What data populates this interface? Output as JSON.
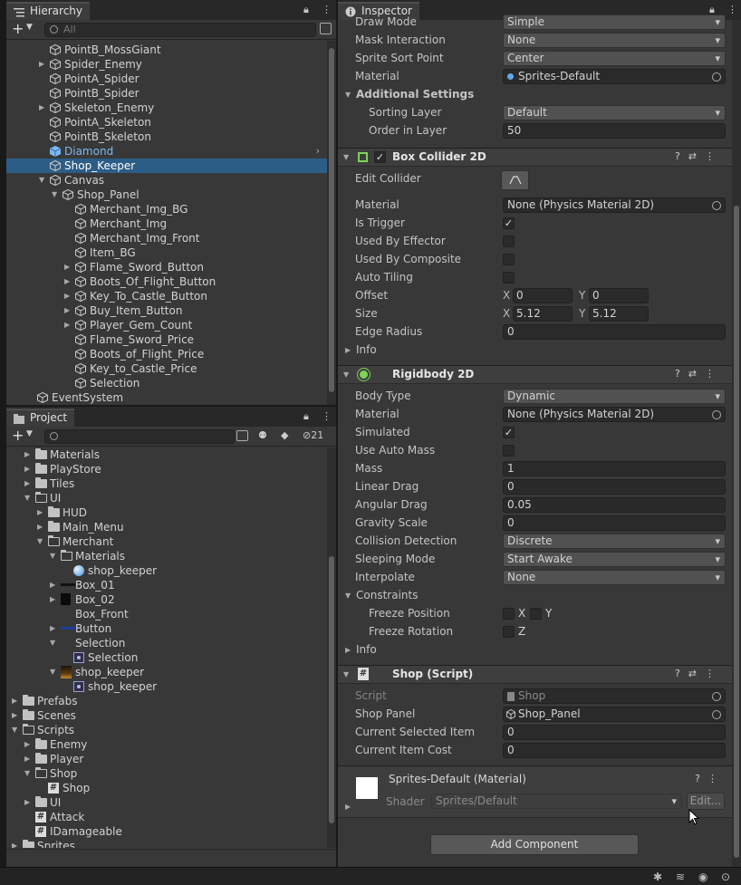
{
  "hierarchy": {
    "tab_label": "Hierarchy",
    "search_placeholder": "All",
    "lock_count": "",
    "items": [
      {
        "label": "PointB_MossGiant",
        "depth": 2,
        "arrow": "",
        "icon": "cube",
        "selected": false
      },
      {
        "label": "Spider_Enemy",
        "depth": 2,
        "arrow": "▶",
        "icon": "cube",
        "selected": false
      },
      {
        "label": "PointA_Spider",
        "depth": 2,
        "arrow": "",
        "icon": "cube",
        "selected": false
      },
      {
        "label": "PointB_Spider",
        "depth": 2,
        "arrow": "",
        "icon": "cube",
        "selected": false
      },
      {
        "label": "Skeleton_Enemy",
        "depth": 2,
        "arrow": "▶",
        "icon": "cube",
        "selected": false
      },
      {
        "label": "PointA_Skeleton",
        "depth": 2,
        "arrow": "",
        "icon": "cube",
        "selected": false
      },
      {
        "label": "PointB_Skeleton",
        "depth": 2,
        "arrow": "",
        "icon": "cube",
        "selected": false
      },
      {
        "label": "Diamond",
        "depth": 2,
        "arrow": "",
        "icon": "prefab",
        "selected": false,
        "prefab": true
      },
      {
        "label": "Shop_Keeper",
        "depth": 2,
        "arrow": "",
        "icon": "cube",
        "selected": true
      },
      {
        "label": "Canvas",
        "depth": 2,
        "arrow": "▼",
        "icon": "cube",
        "selected": false
      },
      {
        "label": "Shop_Panel",
        "depth": 3,
        "arrow": "▼",
        "icon": "cube",
        "selected": false
      },
      {
        "label": "Merchant_Img_BG",
        "depth": 4,
        "arrow": "",
        "icon": "cube",
        "selected": false
      },
      {
        "label": "Merchant_Img",
        "depth": 4,
        "arrow": "",
        "icon": "cube",
        "selected": false
      },
      {
        "label": "Merchant_Img_Front",
        "depth": 4,
        "arrow": "",
        "icon": "cube",
        "selected": false
      },
      {
        "label": "Item_BG",
        "depth": 4,
        "arrow": "",
        "icon": "cube",
        "selected": false
      },
      {
        "label": "Flame_Sword_Button",
        "depth": 4,
        "arrow": "▶",
        "icon": "cube",
        "selected": false
      },
      {
        "label": "Boots_Of_Flight_Button",
        "depth": 4,
        "arrow": "▶",
        "icon": "cube",
        "selected": false
      },
      {
        "label": "Key_To_Castle_Button",
        "depth": 4,
        "arrow": "▶",
        "icon": "cube",
        "selected": false
      },
      {
        "label": "Buy_Item_Button",
        "depth": 4,
        "arrow": "▶",
        "icon": "cube",
        "selected": false
      },
      {
        "label": "Player_Gem_Count",
        "depth": 4,
        "arrow": "▶",
        "icon": "cube",
        "selected": false
      },
      {
        "label": "Flame_Sword_Price",
        "depth": 4,
        "arrow": "",
        "icon": "cube",
        "selected": false
      },
      {
        "label": "Boots_of_Flight_Price",
        "depth": 4,
        "arrow": "",
        "icon": "cube",
        "selected": false
      },
      {
        "label": "Key_to_Castle_Price",
        "depth": 4,
        "arrow": "",
        "icon": "cube",
        "selected": false
      },
      {
        "label": "Selection",
        "depth": 4,
        "arrow": "",
        "icon": "cube",
        "selected": false
      },
      {
        "label": "EventSystem",
        "depth": 1,
        "arrow": "",
        "icon": "cube",
        "selected": false
      }
    ]
  },
  "project": {
    "tab_label": "Project",
    "hidden_count": "21",
    "items": [
      {
        "label": "Materials",
        "depth": 2,
        "arrow": "▶",
        "icon": "folder"
      },
      {
        "label": "PlayStore",
        "depth": 2,
        "arrow": "▶",
        "icon": "folder"
      },
      {
        "label": "Tiles",
        "depth": 2,
        "arrow": "▶",
        "icon": "folder"
      },
      {
        "label": "UI",
        "depth": 2,
        "arrow": "▼",
        "icon": "folder-open"
      },
      {
        "label": "HUD",
        "depth": 3,
        "arrow": "▶",
        "icon": "folder"
      },
      {
        "label": "Main_Menu",
        "depth": 3,
        "arrow": "▶",
        "icon": "folder"
      },
      {
        "label": "Merchant",
        "depth": 3,
        "arrow": "▼",
        "icon": "folder-open"
      },
      {
        "label": "Materials",
        "depth": 4,
        "arrow": "▼",
        "icon": "folder-open"
      },
      {
        "label": "shop_keeper",
        "depth": 5,
        "arrow": "",
        "icon": "material"
      },
      {
        "label": "Box_01",
        "depth": 4,
        "arrow": "▶",
        "icon": "sprite-dark"
      },
      {
        "label": "Box_02",
        "depth": 4,
        "arrow": "▶",
        "icon": "sprite-black"
      },
      {
        "label": "Box_Front",
        "depth": 4,
        "arrow": "",
        "icon": "none"
      },
      {
        "label": "Button",
        "depth": 4,
        "arrow": "▶",
        "icon": "sprite-blue"
      },
      {
        "label": "Selection",
        "depth": 4,
        "arrow": "▼",
        "icon": "none"
      },
      {
        "label": "Selection",
        "depth": 5,
        "arrow": "",
        "icon": "sprite-asset"
      },
      {
        "label": "shop_keeper",
        "depth": 4,
        "arrow": "▼",
        "icon": "sprite-char"
      },
      {
        "label": "shop_keeper",
        "depth": 5,
        "arrow": "",
        "icon": "sprite-asset"
      },
      {
        "label": "Prefabs",
        "depth": 1,
        "arrow": "▶",
        "icon": "folder"
      },
      {
        "label": "Scenes",
        "depth": 1,
        "arrow": "▶",
        "icon": "folder"
      },
      {
        "label": "Scripts",
        "depth": 1,
        "arrow": "▼",
        "icon": "folder-open"
      },
      {
        "label": "Enemy",
        "depth": 2,
        "arrow": "▶",
        "icon": "folder"
      },
      {
        "label": "Player",
        "depth": 2,
        "arrow": "▶",
        "icon": "folder"
      },
      {
        "label": "Shop",
        "depth": 2,
        "arrow": "▼",
        "icon": "folder-open"
      },
      {
        "label": "Shop",
        "depth": 3,
        "arrow": "",
        "icon": "script"
      },
      {
        "label": "UI",
        "depth": 2,
        "arrow": "▶",
        "icon": "folder"
      },
      {
        "label": "Attack",
        "depth": 2,
        "arrow": "",
        "icon": "script"
      },
      {
        "label": "IDamageable",
        "depth": 2,
        "arrow": "",
        "icon": "script"
      },
      {
        "label": "Sprites",
        "depth": 1,
        "arrow": "▶",
        "icon": "folder"
      }
    ]
  },
  "inspector": {
    "tab_label": "Inspector",
    "sprite_renderer": {
      "draw_mode_label": "Draw Mode",
      "draw_mode": "Simple",
      "mask_label": "Mask Interaction",
      "mask": "None",
      "sort_point_label": "Sprite Sort Point",
      "sort_point": "Center",
      "material_label": "Material",
      "material": "Sprites-Default",
      "additional_label": "Additional Settings",
      "sorting_layer_label": "Sorting Layer",
      "sorting_layer": "Default",
      "order_label": "Order in Layer",
      "order": "50"
    },
    "box_collider": {
      "title": "Box Collider 2D",
      "edit_label": "Edit Collider",
      "material_label": "Material",
      "material": "None (Physics Material 2D)",
      "trigger_label": "Is Trigger",
      "trigger": true,
      "effector_label": "Used By Effector",
      "effector": false,
      "composite_label": "Used By Composite",
      "composite": false,
      "tiling_label": "Auto Tiling",
      "tiling": false,
      "offset_label": "Offset",
      "offset_x": "0",
      "offset_y": "0",
      "size_label": "Size",
      "size_x": "5.12",
      "size_y": "5.12",
      "edge_label": "Edge Radius",
      "edge": "0",
      "info_label": "Info"
    },
    "rigidbody": {
      "title": "Rigidbody 2D",
      "body_type_label": "Body Type",
      "body_type": "Dynamic",
      "material_label": "Material",
      "material": "None (Physics Material 2D)",
      "simulated_label": "Simulated",
      "simulated": true,
      "auto_mass_label": "Use Auto Mass",
      "auto_mass": false,
      "mass_label": "Mass",
      "mass": "1",
      "linear_drag_label": "Linear Drag",
      "linear_drag": "0",
      "angular_drag_label": "Angular Drag",
      "angular_drag": "0.05",
      "gravity_label": "Gravity Scale",
      "gravity": "0",
      "collision_label": "Collision Detection",
      "collision": "Discrete",
      "sleeping_label": "Sleeping Mode",
      "sleeping": "Start Awake",
      "interpolate_label": "Interpolate",
      "interpolate": "None",
      "constraints_label": "Constraints",
      "freeze_pos_label": "Freeze Position",
      "x_label": "X",
      "y_label": "Y",
      "freeze_rot_label": "Freeze Rotation",
      "z_label": "Z",
      "info_label": "Info"
    },
    "shop_script": {
      "title": "Shop (Script)",
      "script_label": "Script",
      "script": "Shop",
      "panel_label": "Shop Panel",
      "panel": "Shop_Panel",
      "selected_label": "Current Selected Item",
      "selected": "0",
      "cost_label": "Current Item Cost",
      "cost": "0"
    },
    "material": {
      "title": "Sprites-Default (Material)",
      "shader_label": "Shader",
      "shader": "Sprites/Default",
      "edit_label": "Edit..."
    },
    "add_component": "Add Component"
  },
  "colors": {
    "accent": "#2c5d87",
    "prefab": "#7cb9f0",
    "bg": "#383838"
  }
}
